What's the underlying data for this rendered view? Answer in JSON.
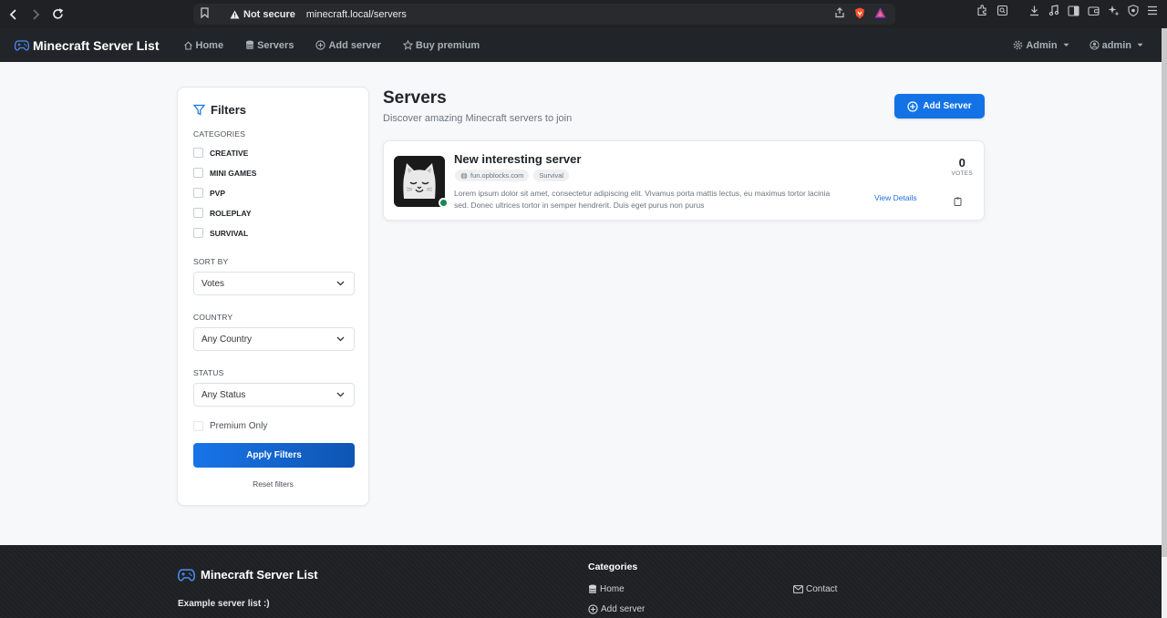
{
  "browser": {
    "security": "Not secure",
    "url": "minecraft.local/servers"
  },
  "nav": {
    "brand": "Minecraft Server List",
    "links": [
      "Home",
      "Servers",
      "Add server",
      "Buy premium"
    ],
    "admin": "Admin",
    "user": "admin"
  },
  "filters": {
    "title": "Filters",
    "categories_label": "CATEGORIES",
    "categories": [
      "CREATIVE",
      "MINI GAMES",
      "PVP",
      "ROLEPLAY",
      "SURVIVAL"
    ],
    "sort_label": "SORT BY",
    "sort_value": "Votes",
    "country_label": "COUNTRY",
    "country_value": "Any Country",
    "status_label": "STATUS",
    "status_value": "Any Status",
    "premium_label": "Premium Only",
    "apply_label": "Apply Filters",
    "reset_label": "Reset filters"
  },
  "main": {
    "title": "Servers",
    "subtitle": "Discover amazing Minecraft servers to join",
    "add_button": "Add Server"
  },
  "server": {
    "name": "New interesting server",
    "address": "fun.opblocks.com",
    "category": "Survival",
    "description": "Lorem ipsum dolor sit amet, consectetur adipiscing elit. Vivamus porta mattis lectus, eu maximus tortor lacinia sed. Donec ultrices tortor in semper hendrerit. Duis eget purus non purus",
    "votes": "0",
    "votes_label": "VOTES",
    "view_details": "View Details",
    "status": "online"
  },
  "footer": {
    "brand": "Minecraft Server List",
    "description": "Example server list :)",
    "categories_title": "Categories",
    "links": [
      "Home",
      "Add server",
      "Contact"
    ]
  },
  "colors": {
    "primary": "#1373e6",
    "navbar": "#212529",
    "online": "#198754"
  }
}
